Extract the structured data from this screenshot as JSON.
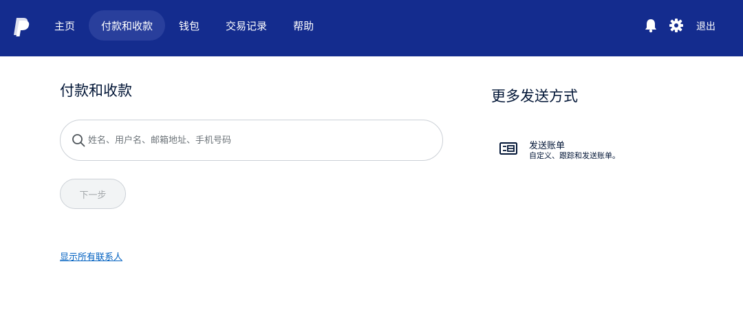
{
  "header": {
    "nav": [
      {
        "label": "主页"
      },
      {
        "label": "付款和收款"
      },
      {
        "label": "钱包"
      },
      {
        "label": "交易记录"
      },
      {
        "label": "帮助"
      }
    ],
    "active_nav": "付款和收款",
    "logout_label": "退出",
    "icons": [
      "paypal-logo-icon",
      "bell-icon",
      "gear-icon"
    ]
  },
  "main": {
    "title": "付款和收款",
    "search": {
      "placeholder": "姓名、用户名、邮箱地址、手机号码",
      "value": ""
    },
    "next_button": "下一步",
    "contacts_link": "显示所有联系人"
  },
  "sidebar": {
    "title": "更多发送方式",
    "invoice": {
      "title": "发送账单",
      "description": "自定义、跟踪和发送账单。",
      "icon": "invoice-icon"
    }
  },
  "colors": {
    "header_bg": "#142c8e",
    "active_pill": "#293f9c",
    "link": "#0060c0"
  }
}
